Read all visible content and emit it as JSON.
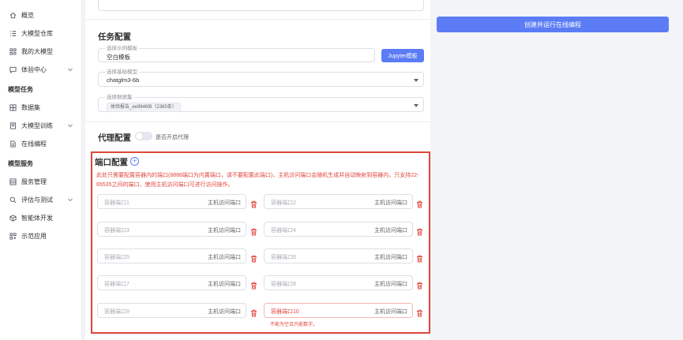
{
  "sidebar": {
    "items": [
      {
        "label": "概览",
        "icon": "home-icon"
      },
      {
        "label": "大模型仓库",
        "icon": "list-icon"
      },
      {
        "label": "我的大模型",
        "icon": "grid-icon"
      },
      {
        "label": "体验中心",
        "icon": "chat-icon",
        "expandable": true
      }
    ],
    "group_model_task": "模型任务",
    "task_items": [
      {
        "label": "数据集",
        "icon": "table-icon"
      },
      {
        "label": "大模型训练",
        "icon": "book-icon",
        "expandable": true
      },
      {
        "label": "在线编程",
        "icon": "file-icon"
      }
    ],
    "group_model_service": "模型服务",
    "service_items": [
      {
        "label": "服务管理",
        "icon": "server-icon"
      },
      {
        "label": "评估与测试",
        "icon": "search-icon",
        "expandable": true
      },
      {
        "label": "智能体开发",
        "icon": "cube-icon"
      },
      {
        "label": "示范应用",
        "icon": "apps-icon"
      }
    ]
  },
  "right": {
    "run_label": "创建并运行在线编程"
  },
  "task": {
    "title": "任务配置",
    "template_label": "选择示例模板",
    "template_value": "空白模板",
    "jupyter_label": "Jupyter模板",
    "base_model_label": "选择基础模型",
    "base_model_value": "chatglm3-6b",
    "dataset_label": "选择数据集",
    "dataset_tag": "体验报告_ee9646f8（2365条）"
  },
  "proxy": {
    "title": "代理配置",
    "toggle_label": "是否开启代理",
    "enabled": false
  },
  "ports": {
    "title": "端口配置",
    "warning": "此处只需要配置容器内的端口(8888端口为内置端口，请不要配置此端口)，主机访问端口会随机生成并自动映射到容器内，只支持22-65535之间的端口，使用主机访问端口可进行访问操作。",
    "host_placeholder": "主机访问端口",
    "rows": [
      {
        "left": "容器端口1",
        "right": "容器端口2"
      },
      {
        "left": "容器端口3",
        "right": "容器端口4"
      },
      {
        "left": "容器端口5",
        "right": "容器端口6"
      },
      {
        "left": "容器端口7",
        "right": "容器端口8"
      },
      {
        "left": "容器端口9",
        "right": "容器端口10"
      }
    ],
    "error_message": "不能为空且只能数字。"
  },
  "colors": {
    "accent": "#5b7cf5",
    "error": "#e0463c"
  }
}
